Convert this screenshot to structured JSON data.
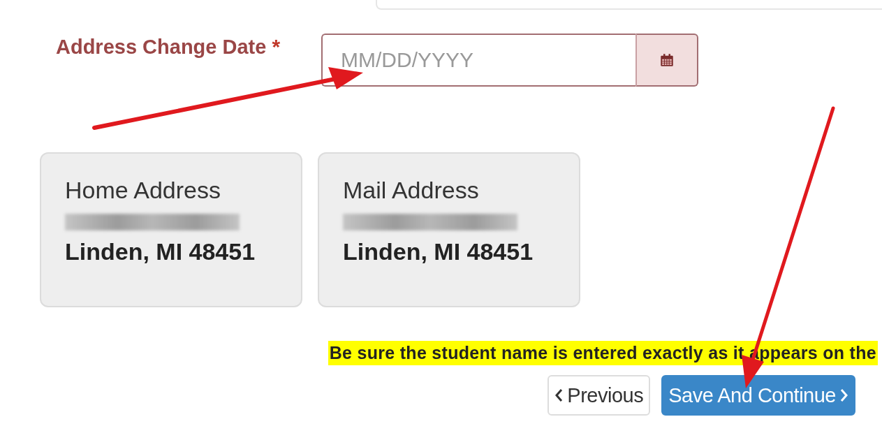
{
  "date_field": {
    "label": "Address Change Date",
    "required_mark": "*",
    "placeholder": "MM/DD/YYYY"
  },
  "addresses": [
    {
      "title": "Home Address",
      "city_line": "Linden, MI 48451"
    },
    {
      "title": "Mail Address",
      "city_line": "Linden, MI 48451"
    }
  ],
  "notice": "Be sure the student name is entered exactly as it appears on the",
  "buttons": [
    {
      "kind": "back",
      "label": "Previous"
    },
    {
      "kind": "next",
      "label": "Save And Continue"
    }
  ]
}
